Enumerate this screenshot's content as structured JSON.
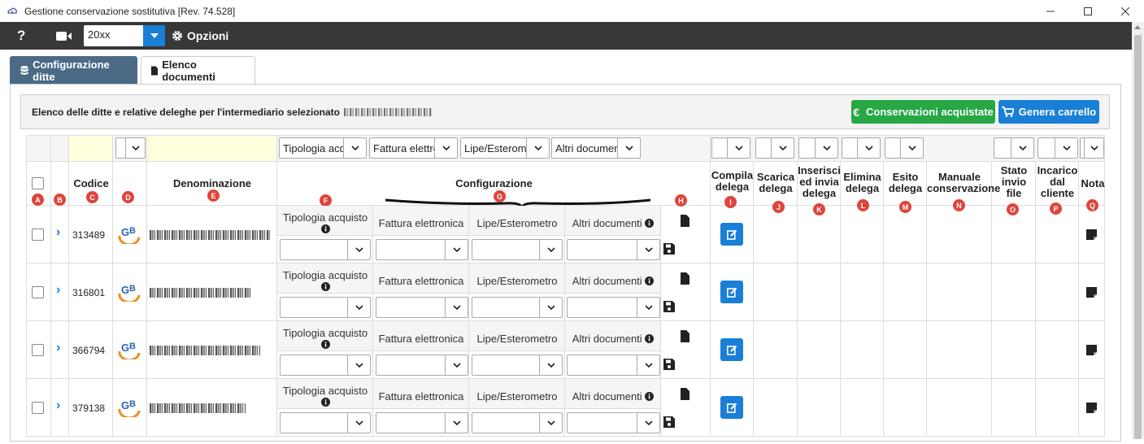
{
  "window": {
    "title": "Gestione conservazione sostitutiva [Rev. 74.528]"
  },
  "toolbar": {
    "help_label": "?",
    "year_value": "20xx",
    "options_label": "Opzioni"
  },
  "tabs": [
    {
      "label": "Configurazione ditte",
      "icon": "database-icon",
      "active": true
    },
    {
      "label": "Elenco documenti",
      "icon": "file-icon",
      "active": false
    }
  ],
  "panel": {
    "description": "Elenco delle ditte e relative deleghe per l'intermediario selezionato",
    "buy_button": "Conservazioni acquistate",
    "buy_icon": "€",
    "cart_button": "Genera carrello"
  },
  "filters": {
    "tipologia": "Tipologia acquisto",
    "fattura": "Fattura elettronica",
    "lipe": "Lipe/Esterometro",
    "altri": "Altri documenti"
  },
  "columns": {
    "codice": "Codice",
    "denominazione": "Denominazione",
    "configurazione": "Configurazione",
    "compila": [
      "Compila",
      "delega"
    ],
    "scarica": [
      "Scarica",
      "delega"
    ],
    "inserisci": [
      "Inserisci",
      "ed invia",
      "delega"
    ],
    "elimina": [
      "Elimina",
      "delega"
    ],
    "esito": [
      "Esito",
      "delega"
    ],
    "manuale": [
      "Manuale",
      "conservazione"
    ],
    "stato": [
      "Stato",
      "invio",
      "file"
    ],
    "incarico": [
      "Incarico",
      "dal",
      "cliente"
    ],
    "nota": "Nota"
  },
  "badges": [
    "A",
    "B",
    "C",
    "D",
    "E",
    "F",
    "G",
    "H",
    "I",
    "J",
    "K",
    "L",
    "M",
    "N",
    "O",
    "P",
    "Q"
  ],
  "config_labels": {
    "tipologia": "Tipologia acquisto",
    "fattura": "Fattura elettronica",
    "lipe": "Lipe/Esterometro",
    "altri": "Altri documenti"
  },
  "rows": [
    {
      "codice": "313489"
    },
    {
      "codice": "316801"
    },
    {
      "codice": "366794"
    },
    {
      "codice": "379138"
    }
  ],
  "colors": {
    "toolbar": "#383838",
    "accent_blue": "#1a7fd6",
    "green": "#28a745",
    "tab_active": "#4a6a86",
    "badge_red": "#e0443a"
  }
}
